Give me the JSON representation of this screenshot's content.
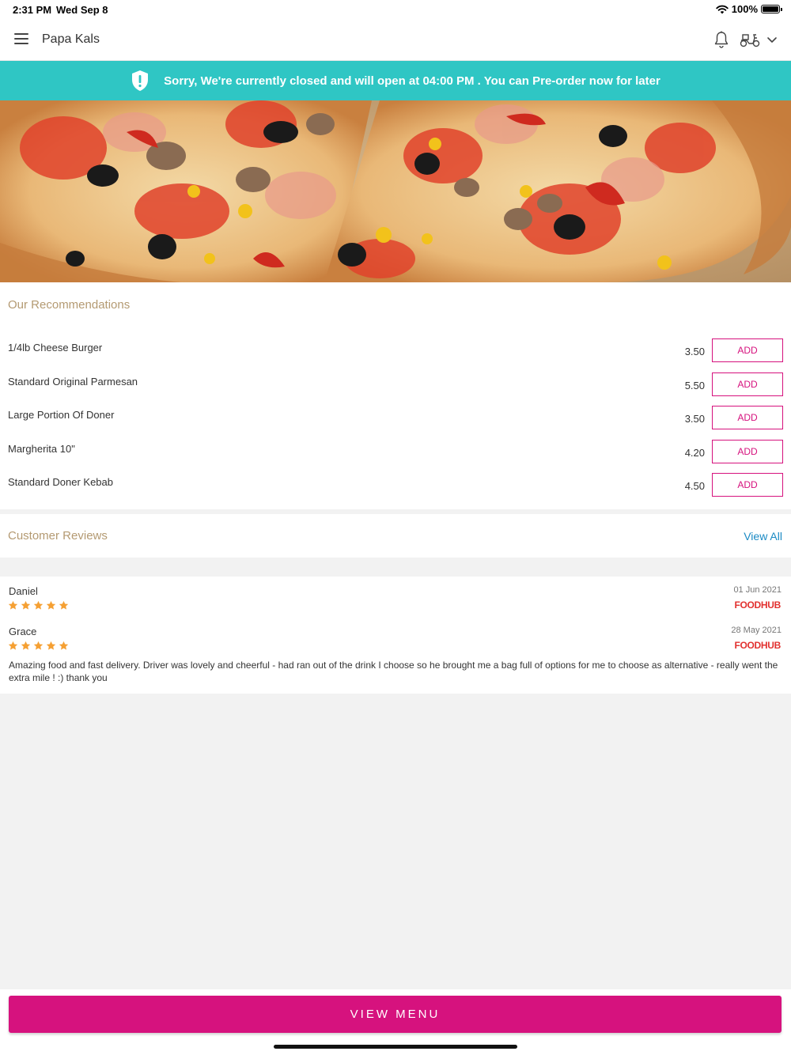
{
  "status_bar": {
    "time": "2:31 PM",
    "date": "Wed Sep 8",
    "battery": "100%"
  },
  "header": {
    "title": "Papa Kals"
  },
  "banner": {
    "text": "Sorry, We're currently closed and will open at 04:00 PM . You can Pre-order now for later"
  },
  "recommendations": {
    "title": "Our Recommendations",
    "items": [
      {
        "name": "1/4lb Cheese Burger",
        "price": "3.50",
        "action": "ADD"
      },
      {
        "name": "Standard Original Parmesan",
        "price": "5.50",
        "action": "ADD"
      },
      {
        "name": "Large Portion Of Doner",
        "price": "3.50",
        "action": "ADD"
      },
      {
        "name": "Margherita 10\"",
        "price": "4.20",
        "action": "ADD"
      },
      {
        "name": "Standard Doner Kebab",
        "price": "4.50",
        "action": "ADD"
      }
    ]
  },
  "reviews": {
    "title": "Customer Reviews",
    "view_all": "View All",
    "items": [
      {
        "name": "Daniel",
        "date": "01 Jun 2021",
        "rating": 5,
        "source": "FOODHUB",
        "text": ""
      },
      {
        "name": "Grace",
        "date": "28 May 2021",
        "rating": 5,
        "source": "FOODHUB",
        "text": "Amazing food and fast delivery. Driver was lovely and cheerful - had ran out of the drink I choose so he brought me a bag full of options for me to choose as alternative - really went the extra mile ! :) thank you"
      }
    ]
  },
  "cta": {
    "label": "VIEW MENU"
  },
  "colors": {
    "accent": "#d6127e",
    "banner": "#2fc6c4",
    "section_title": "#b49a72",
    "link": "#1a8ac4",
    "star": "#f5a033",
    "foodhub": "#e2312f"
  },
  "icons": [
    "menu-icon",
    "bell-icon",
    "scooter-icon",
    "chevron-down-icon",
    "shield-alert-icon",
    "star-icon",
    "wifi-icon",
    "battery-icon"
  ]
}
